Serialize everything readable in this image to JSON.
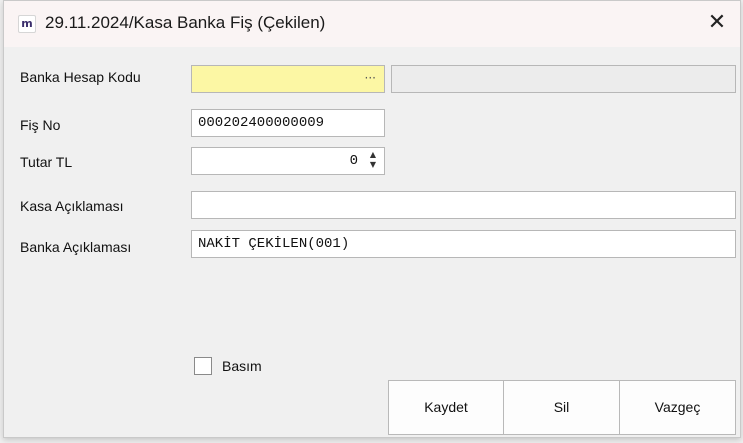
{
  "window": {
    "icon_glyph": "m",
    "title": "29.11.2024/Kasa Banka Fiş (Çekilen)",
    "close_glyph": "✕"
  },
  "form": {
    "banka_hesap_kodu": {
      "label": "Banka Hesap Kodu",
      "value": "",
      "lookup_glyph": "···",
      "description": ""
    },
    "fis_no": {
      "label": "Fiş No",
      "value": "000202400000009"
    },
    "tutar_tl": {
      "label": "Tutar TL",
      "value": "0",
      "spin_up": "▲",
      "spin_down": "▼"
    },
    "kasa_aciklamasi": {
      "label": "Kasa Açıklaması",
      "value": ""
    },
    "banka_aciklamasi": {
      "label": "Banka Açıklaması",
      "value": "NAKİT ÇEKİLEN(001)"
    }
  },
  "basim": {
    "label": "Basım",
    "checked": false
  },
  "buttons": {
    "kaydet": "Kaydet",
    "sil": "Sil",
    "vazgec": "Vazgeç"
  },
  "colors": {
    "highlight_field": "#fcf7a4",
    "titlebar": "#faf4f4",
    "window_bg": "#f0f0f0"
  }
}
